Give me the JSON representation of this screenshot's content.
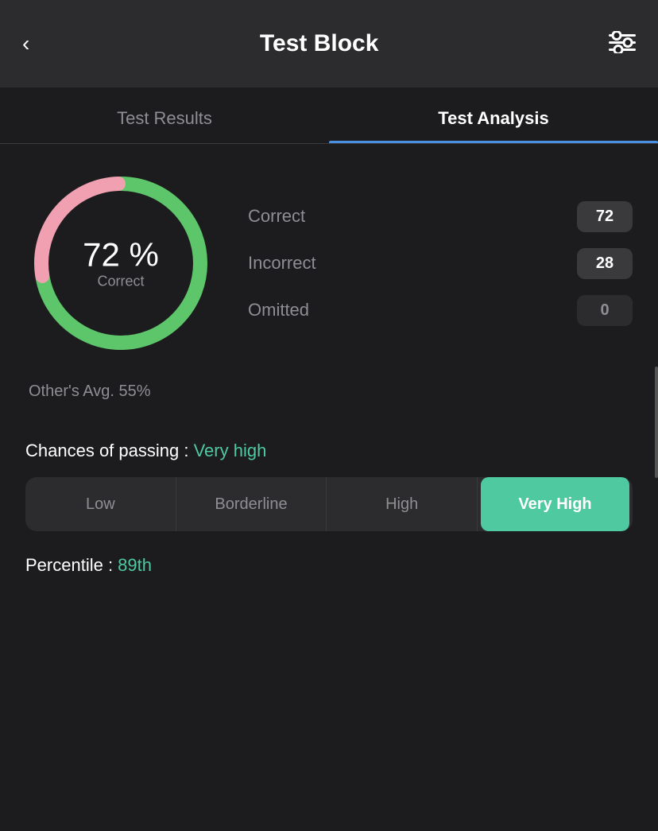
{
  "header": {
    "back_label": "‹",
    "title": "Test Block",
    "settings_icon": "⚙"
  },
  "tabs": [
    {
      "id": "results",
      "label": "Test Results",
      "active": false
    },
    {
      "id": "analysis",
      "label": "Test Analysis",
      "active": true
    }
  ],
  "score": {
    "percent": "72",
    "percent_symbol": "%",
    "correct_label": "Correct",
    "donut": {
      "correct_ratio": 0.72,
      "incorrect_ratio": 0.28,
      "green_color": "#5dc66a",
      "pink_color": "#f0a0b0",
      "bg_color": "#2c2c2e",
      "stroke_width": 18,
      "radius": 100
    }
  },
  "stats": [
    {
      "label": "Correct",
      "value": "72",
      "style": "normal"
    },
    {
      "label": "Incorrect",
      "value": "28",
      "style": "normal"
    },
    {
      "label": "Omitted",
      "value": "0",
      "style": "omitted"
    }
  ],
  "others_avg": "Other's Avg. 55%",
  "chances": {
    "label": "Chances of passing : ",
    "value": "Very high",
    "color": "#4ec9a0"
  },
  "passing_segments": [
    {
      "label": "Low",
      "active": false
    },
    {
      "label": "Borderline",
      "active": false
    },
    {
      "label": "High",
      "active": false
    },
    {
      "label": "Very High",
      "active": true
    }
  ],
  "percentile": {
    "label": "Percentile : ",
    "value": "89th",
    "color": "#4ec9a0"
  }
}
